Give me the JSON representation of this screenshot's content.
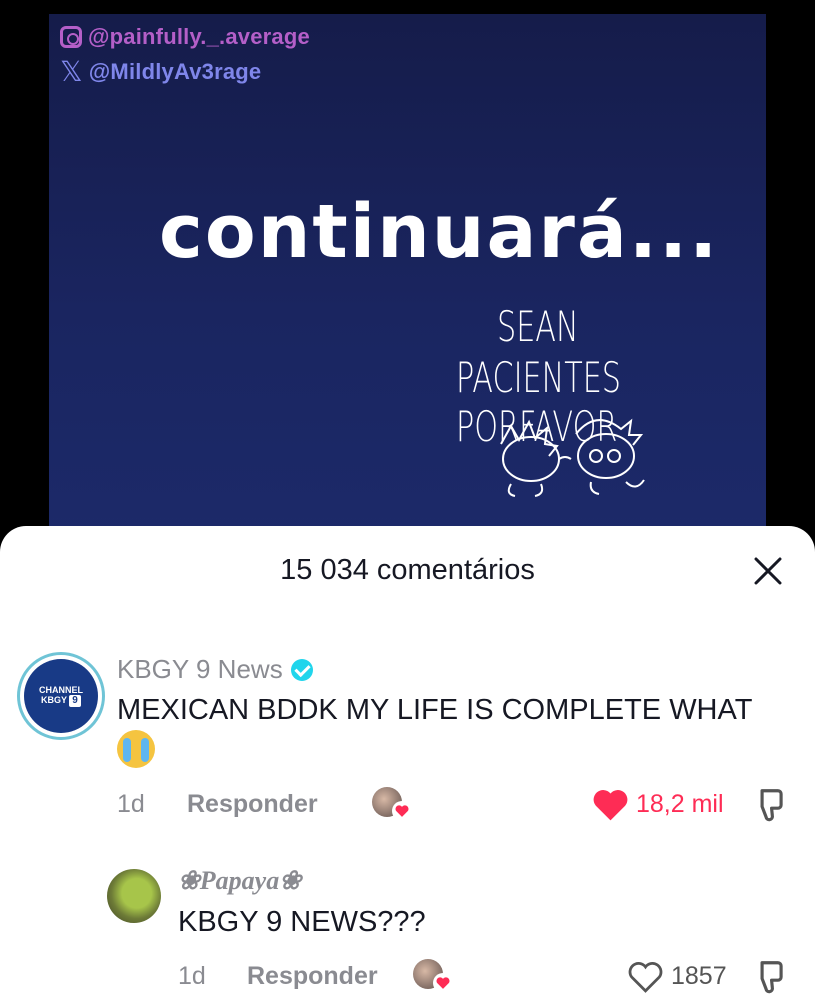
{
  "video": {
    "instagram_handle": "@painfully._.average",
    "x_handle": "@MildlyAv3rage",
    "caption": "continuará...",
    "sign_line1": "SEAN",
    "sign_line2": "PACIENTES PORFAVOR"
  },
  "comments_panel": {
    "title": "15 034 comentários",
    "close_icon": "close-icon",
    "comments": [
      {
        "username": "KBGY 9 News",
        "verified": true,
        "avatar_text_top": "CHANNEL",
        "avatar_text_bottom": "KBGY",
        "avatar_badge": "9",
        "text": "MEXICAN BDDK MY LIFE IS COMPLETE WHAT",
        "emoji": "crying-face-icon",
        "time": "1d",
        "reply_label": "Responder",
        "likes": "18,2 mil",
        "liked": true
      },
      {
        "username": "❀Papaya❀",
        "text": "KBGY 9 NEWS???",
        "time": "1d",
        "reply_label": "Responder",
        "likes": "1857",
        "liked": false
      }
    ]
  },
  "colors": {
    "like_red": "#fe2c55",
    "meta_gray": "#8a8b91",
    "text_dark": "#161823",
    "video_bg": "#1a2560"
  }
}
